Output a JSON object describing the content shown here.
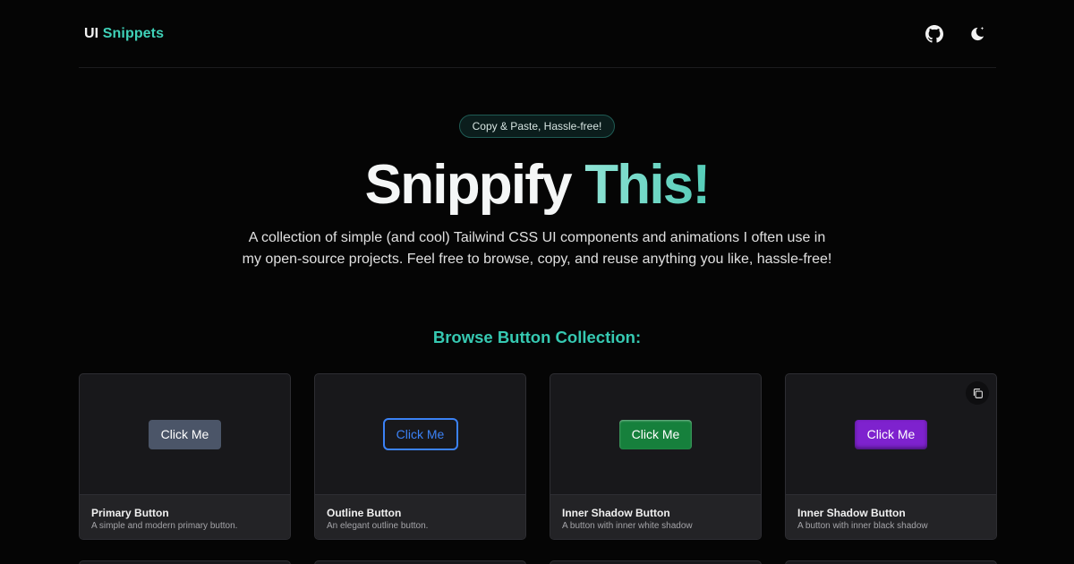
{
  "header": {
    "logo_prefix": "UI",
    "logo_suffix": "Snippets",
    "icons": [
      "github-icon",
      "moon-icon"
    ]
  },
  "hero": {
    "badge": "Copy & Paste, Hassle-free!",
    "title_part1": "Snippify",
    "title_part2": "This!",
    "description": "A collection of simple (and cool) Tailwind CSS UI components and animations I often use in my open-source projects. Feel free to browse, copy, and reuse anything you like, hassle-free!"
  },
  "section": {
    "title": "Browse Button Collection:"
  },
  "cards": [
    {
      "button_label": "Click Me",
      "name": "Primary Button",
      "description": "A simple and modern primary button."
    },
    {
      "button_label": "Click Me",
      "name": "Outline Button",
      "description": "An elegant outline button."
    },
    {
      "button_label": "Click Me",
      "name": "Inner Shadow Button",
      "description": "A button with inner white shadow"
    },
    {
      "button_label": "Click Me",
      "name": "Inner Shadow Button",
      "description": "A button with inner black shadow"
    }
  ],
  "colors": {
    "background": "#050505",
    "accent": "#3fd1b8",
    "card_bg": "#18181b",
    "primary_btn": "#4b5568",
    "outline_btn": "#3b82f6",
    "green_btn": "#16803c",
    "purple_btn": "#7e22ce"
  }
}
